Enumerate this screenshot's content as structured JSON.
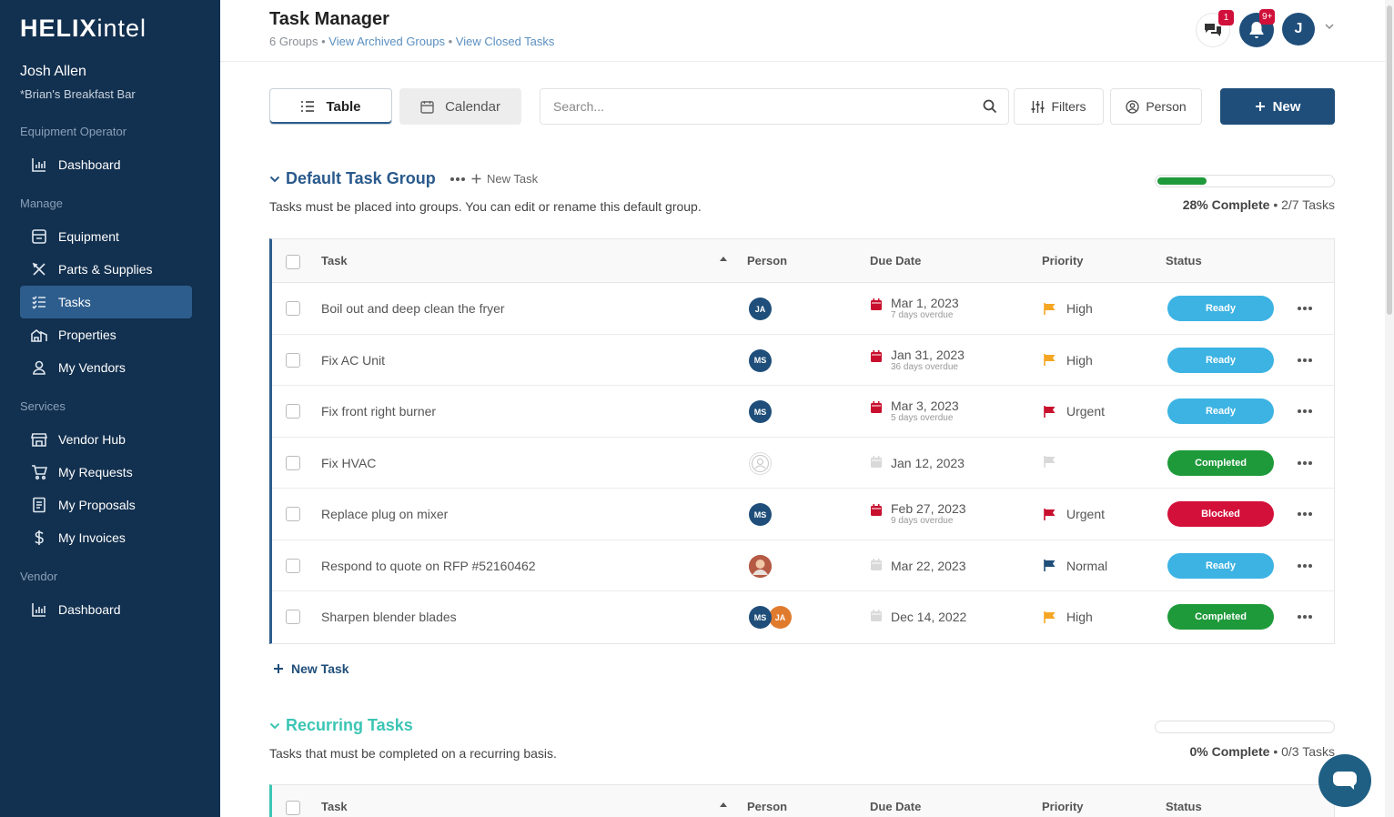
{
  "sidebar": {
    "logo_bold": "HELIX",
    "logo_light": "intel",
    "user_name": "Josh Allen",
    "user_org": "*Brian's Breakfast Bar",
    "sections": {
      "equipment_operator": "Equipment Operator",
      "manage": "Manage",
      "services": "Services",
      "vendor": "Vendor"
    },
    "items": {
      "dashboard1": "Dashboard",
      "equipment": "Equipment",
      "parts": "Parts & Supplies",
      "tasks": "Tasks",
      "properties": "Properties",
      "vendors": "My Vendors",
      "vendor_hub": "Vendor Hub",
      "requests": "My Requests",
      "proposals": "My Proposals",
      "invoices": "My Invoices",
      "dashboard2": "Dashboard"
    }
  },
  "header": {
    "title": "Task Manager",
    "groups_count": "6 Groups",
    "sep": "•",
    "archived_link": "View Archived Groups",
    "closed_link": "View Closed Tasks",
    "chat_badge": "1",
    "notif_badge": "9+",
    "avatar_initial": "J"
  },
  "toolbar": {
    "table_tab": "Table",
    "calendar_tab": "Calendar",
    "search_placeholder": "Search...",
    "filters": "Filters",
    "person": "Person",
    "new": "New"
  },
  "groups": [
    {
      "title": "Default Task Group",
      "new_task": "New Task",
      "description": "Tasks must be placed into groups. You can edit or rename this default group.",
      "progress_fraction": 0.28,
      "progress_pct": "28% Complete",
      "progress_sep": "•",
      "progress_tasks": "2/7 Tasks",
      "columns": {
        "task": "Task",
        "person": "Person",
        "due": "Due Date",
        "priority": "Priority",
        "status": "Status"
      },
      "rows": [
        {
          "task": "Boil out and deep clean the fryer",
          "persons": [
            {
              "initials": "JA",
              "kind": "blue"
            }
          ],
          "due": "Mar 1, 2023",
          "overdue": "7 days overdue",
          "priority": "High",
          "priority_color": "#f5a623",
          "status": "Ready",
          "status_kind": "ready"
        },
        {
          "task": "Fix AC Unit",
          "persons": [
            {
              "initials": "MS",
              "kind": "blue"
            }
          ],
          "due": "Jan 31, 2023",
          "overdue": "36 days overdue",
          "priority": "High",
          "priority_color": "#f5a623",
          "status": "Ready",
          "status_kind": "ready"
        },
        {
          "task": "Fix front right burner",
          "persons": [
            {
              "initials": "MS",
              "kind": "blue"
            }
          ],
          "due": "Mar 3, 2023",
          "overdue": "5 days overdue",
          "priority": "Urgent",
          "priority_color": "#c8102e",
          "status": "Ready",
          "status_kind": "ready"
        },
        {
          "task": "Fix HVAC",
          "persons": [
            {
              "initials": "",
              "kind": "empty"
            }
          ],
          "due": "Jan 12, 2023",
          "overdue": "",
          "priority": "",
          "priority_color": "#d9d9d9",
          "status": "Completed",
          "status_kind": "completed"
        },
        {
          "task": "Replace plug on mixer",
          "persons": [
            {
              "initials": "MS",
              "kind": "blue"
            }
          ],
          "due": "Feb 27, 2023",
          "overdue": "9 days overdue",
          "priority": "Urgent",
          "priority_color": "#c8102e",
          "status": "Blocked",
          "status_kind": "blocked"
        },
        {
          "task": "Respond to quote on RFP #52160462",
          "persons": [
            {
              "initials": "",
              "kind": "photo"
            }
          ],
          "due": "Mar 22, 2023",
          "overdue": "",
          "priority": "Normal",
          "priority_color": "#1f4e7a",
          "status": "Ready",
          "status_kind": "ready"
        },
        {
          "task": "Sharpen blender blades",
          "persons": [
            {
              "initials": "MS",
              "kind": "blue"
            },
            {
              "initials": "JA",
              "kind": "orange"
            }
          ],
          "due": "Dec 14, 2022",
          "overdue": "",
          "priority": "High",
          "priority_color": "#f5a623",
          "status": "Completed",
          "status_kind": "completed"
        }
      ],
      "bottom_new_task": "New Task"
    },
    {
      "title": "Recurring Tasks",
      "description": "Tasks that must be completed on a recurring basis.",
      "progress_fraction": 0,
      "progress_pct": "0% Complete",
      "progress_sep": "•",
      "progress_tasks": "0/3 Tasks",
      "columns": {
        "task": "Task",
        "person": "Person",
        "due": "Due Date",
        "priority": "Priority",
        "status": "Status"
      }
    }
  ],
  "colors": {
    "sidebar_bg": "#12304f",
    "accent": "#1f4e7a",
    "recurring_accent": "#3cc5b4"
  }
}
